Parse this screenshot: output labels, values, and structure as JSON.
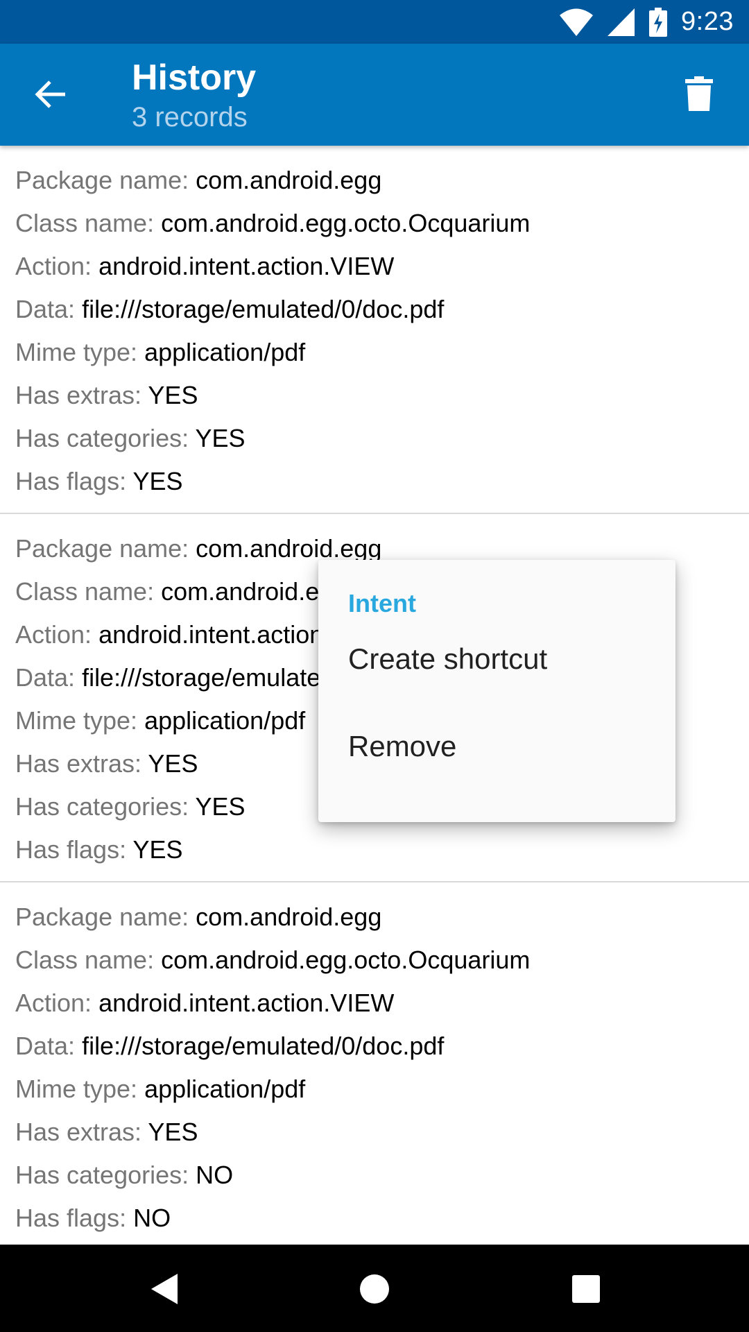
{
  "status_bar": {
    "time": "9:23",
    "icons": [
      "wifi-icon",
      "signal-icon",
      "battery-charging-icon"
    ]
  },
  "app_bar": {
    "title": "History",
    "subtitle": "3 records",
    "back_icon": "arrow-back-icon",
    "delete_icon": "trash-icon"
  },
  "records": [
    {
      "fields": [
        {
          "label": "Package name:",
          "value": "com.android.egg"
        },
        {
          "label": "Class name:",
          "value": "com.android.egg.octo.Ocquarium"
        },
        {
          "label": "Action:",
          "value": "android.intent.action.VIEW"
        },
        {
          "label": "Data:",
          "value": "file:///storage/emulated/0/doc.pdf"
        },
        {
          "label": "Mime type:",
          "value": "application/pdf"
        },
        {
          "label": "Has extras:",
          "value": "YES"
        },
        {
          "label": "Has categories:",
          "value": "YES"
        },
        {
          "label": "Has flags:",
          "value": "YES"
        }
      ]
    },
    {
      "fields": [
        {
          "label": "Package name:",
          "value": "com.android.egg"
        },
        {
          "label": "Class name:",
          "value": "com.android.egg.octo.Ocquarium"
        },
        {
          "label": "Action:",
          "value": "android.intent.action.VIEW"
        },
        {
          "label": "Data:",
          "value": "file:///storage/emulated/0/doc.pdf"
        },
        {
          "label": "Mime type:",
          "value": "application/pdf"
        },
        {
          "label": "Has extras:",
          "value": "YES"
        },
        {
          "label": "Has categories:",
          "value": "YES"
        },
        {
          "label": "Has flags:",
          "value": "YES"
        }
      ]
    },
    {
      "fields": [
        {
          "label": "Package name:",
          "value": "com.android.egg"
        },
        {
          "label": "Class name:",
          "value": "com.android.egg.octo.Ocquarium"
        },
        {
          "label": "Action:",
          "value": "android.intent.action.VIEW"
        },
        {
          "label": "Data:",
          "value": "file:///storage/emulated/0/doc.pdf"
        },
        {
          "label": "Mime type:",
          "value": "application/pdf"
        },
        {
          "label": "Has extras:",
          "value": "YES"
        },
        {
          "label": "Has categories:",
          "value": "NO"
        },
        {
          "label": "Has flags:",
          "value": "NO"
        }
      ]
    }
  ],
  "popup_menu": {
    "header": "Intent",
    "items": [
      {
        "label": "Create shortcut"
      },
      {
        "label": "Remove"
      }
    ]
  },
  "nav_bar": {
    "icons": [
      "nav-back-icon",
      "nav-home-icon",
      "nav-recents-icon"
    ]
  },
  "colors": {
    "status_bar": "#01579b",
    "app_bar": "#0277bd",
    "menu_header": "#29a8e0",
    "label_gray": "#757575"
  }
}
